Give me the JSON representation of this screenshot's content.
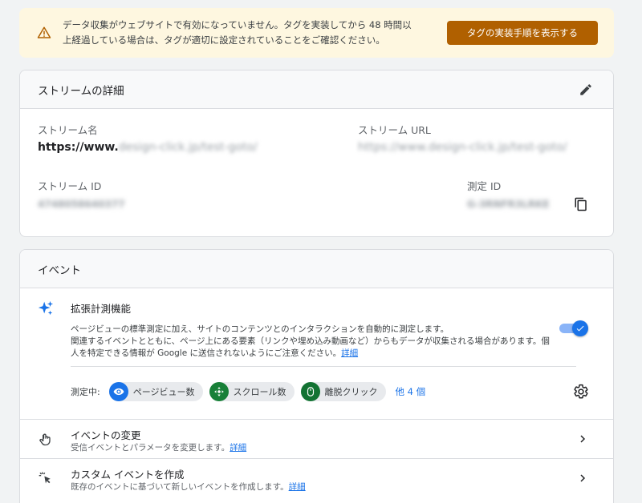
{
  "banner": {
    "message_line1": "データ収集がウェブサイトで有効になっていません。タグを実装してから 48 時間以",
    "message_line2": "上経過している場合は、タグが適切に設定されていることをご確認ください。",
    "button_label": "タグの実装手順を表示する",
    "icon": "warning-icon"
  },
  "stream_details": {
    "title": "ストリームの詳細",
    "edit_icon": "pencil-icon",
    "stream_name_label": "ストリーム名",
    "stream_name_value_visible": "https://www.",
    "stream_name_value_blurred": "design-click.jp/test-goto/",
    "stream_url_label": "ストリーム URL",
    "stream_url_value_blurred": "https://www.design-click.jp/test-goto/",
    "stream_id_label": "ストリーム ID",
    "stream_id_value_blurred": "4748058640377",
    "measurement_id_label": "測定 ID",
    "measurement_id_value_blurred": "G-3RNFR3LRKE",
    "copy_icon": "copy-icon"
  },
  "events": {
    "title": "イベント",
    "enhanced": {
      "title": "拡張計測機能",
      "desc_line1": "ページビューの標準測定に加え、サイトのコンテンツとのインタラクションを自動的に測定します。",
      "desc_line2": "関連するイベントとともに、ページ上にある要素（リンクや埋め込み動画など）からもデータが収集される場合があります。個",
      "desc_line3": "人を特定できる情報が Google に送信されないようにご注意ください。",
      "link": "詳細",
      "toggle_on": true,
      "icon": "sparkle-icon",
      "measuring_label": "測定中:",
      "chips": [
        {
          "label": "ページビュー数",
          "icon": "eye-icon",
          "color": "#1a73e8"
        },
        {
          "label": "スクロール数",
          "icon": "crosshair-icon",
          "color": "#188038"
        },
        {
          "label": "離脱クリック",
          "icon": "mouse-icon",
          "color": "#137333"
        }
      ],
      "more_label": "他 4 個",
      "settings_icon": "gear-icon"
    },
    "rows": [
      {
        "title": "イベントの変更",
        "desc": "受信イベントとパラメータを変更します。",
        "link": "詳細",
        "icon": "touch-icon"
      },
      {
        "title": "カスタム イベントを作成",
        "desc": "既存のイベントに基づいて新しいイベントを作成します。",
        "link": "詳細",
        "icon": "click-icon"
      }
    ]
  }
}
